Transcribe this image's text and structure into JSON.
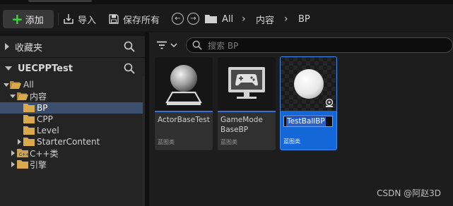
{
  "toolbar": {
    "add_label": "添加",
    "import_label": "导入",
    "save_all_label": "保存所有",
    "nav_back_icon": "arrow-left-icon",
    "nav_forward_icon": "arrow-right-icon",
    "breadcrumb": [
      "All",
      "内容",
      "BP"
    ]
  },
  "sidebar": {
    "favorites_label": "收藏夹",
    "project_label": "UECPPTest",
    "tree": [
      {
        "label": "All",
        "expanded": true,
        "depth": 0
      },
      {
        "label": "内容",
        "expanded": true,
        "depth": 1
      },
      {
        "label": "BP",
        "selected": true,
        "depth": 2
      },
      {
        "label": "CPP",
        "depth": 2
      },
      {
        "label": "Level",
        "depth": 2
      },
      {
        "label": "StarterContent",
        "depth": 2
      },
      {
        "label": "C++类",
        "depth": 1
      },
      {
        "label": "引擎",
        "depth": 1
      }
    ]
  },
  "content": {
    "search_placeholder": "搜索 BP",
    "assets": [
      {
        "name": "ActorBaseTest",
        "type": "蓝图类",
        "thumb": "sphere-on-pedestal"
      },
      {
        "name": "GameModeBaseBP",
        "name_lines": [
          "GameMode",
          "BaseBP"
        ],
        "type": "蓝图类",
        "thumb": "gamepad-monitor"
      },
      {
        "name": "TestBallBP",
        "type": "蓝图类",
        "thumb": "white-sphere",
        "selected": true,
        "renaming": true
      }
    ]
  },
  "watermark": "CSDN @阿赵3D",
  "colors": {
    "accent": "#1467d6",
    "selection_tree": "#3c4f6e",
    "add_plus": "#3ddc3d",
    "asset_bar": "#3a6fd8"
  }
}
